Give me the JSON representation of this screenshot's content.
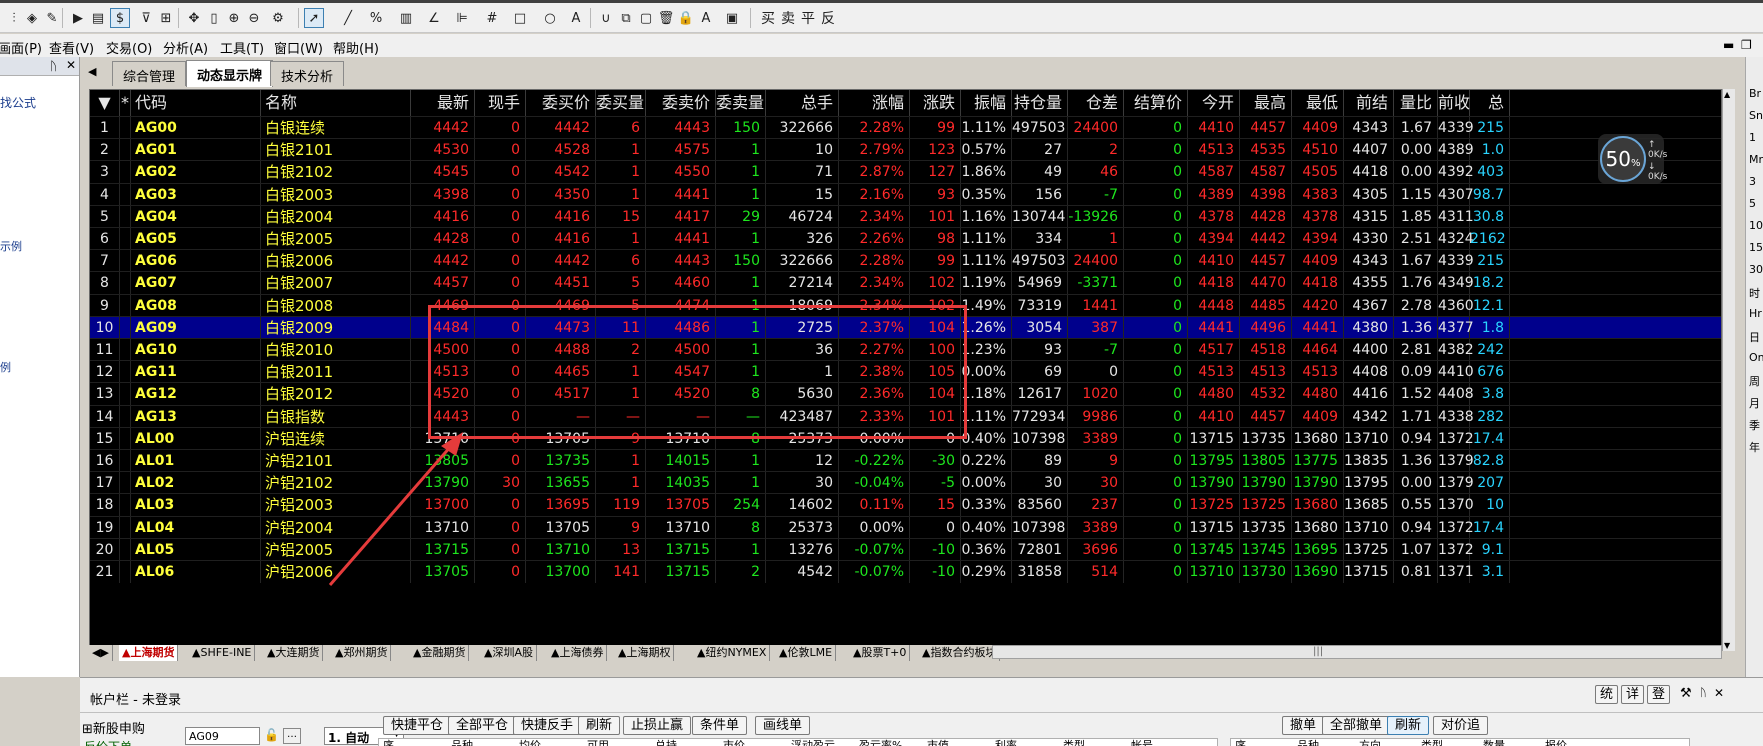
{
  "toolbar": {
    "currency_symbol": "$",
    "buy": "买",
    "sell": "卖",
    "close": "平",
    "reverse": "反"
  },
  "menu": [
    "画面(P)",
    "查看(V)",
    "交易(O)",
    "分析(A)",
    "工具(T)",
    "窗口(W)",
    "帮助(H)"
  ],
  "left_panel": {
    "items": [
      "找公式",
      "示例",
      "例"
    ]
  },
  "tabs": [
    "综合管理",
    "动态显示牌",
    "技术分析"
  ],
  "colors": {
    "up": "#ff2a2a",
    "down": "#1ee61e",
    "flat": "#e6e6e6",
    "name": "#ffff3c",
    "volume_ratio_value": "#2ad4ff",
    "selected_row": "#00008c",
    "annotation": "#e53b3b"
  },
  "table": {
    "columns": [
      "▼",
      "*",
      "代码",
      "名称",
      "最新",
      "现手",
      "委买价",
      "委买量",
      "委卖价",
      "委卖量",
      "总手",
      "涨幅",
      "涨跌",
      "振幅",
      "持仓量",
      "仓差",
      "结算价",
      "今开",
      "最高",
      "最低",
      "前结",
      "量比",
      "前收",
      "总"
    ],
    "selected_row": 10,
    "rows": [
      {
        "n": "1",
        "code": "AG00",
        "name": "白银连续",
        "last": "4442",
        "cur": "0",
        "bid": "4442",
        "bidq": "6",
        "ask": "4443",
        "askq": "150",
        "vol": "322666",
        "pct": "2.28%",
        "chg": "99",
        "amp": "1.11%",
        "oi": "497503",
        "oid": "24400",
        "settle": "0",
        "open": "4410",
        "high": "4457",
        "low": "4409",
        "pset": "4343",
        "vr": "1.67",
        "pclose": "4339",
        "tot": "215"
      },
      {
        "n": "2",
        "code": "AG01",
        "name": "白银2101",
        "last": "4530",
        "cur": "0",
        "bid": "4528",
        "bidq": "1",
        "ask": "4575",
        "askq": "1",
        "vol": "10",
        "pct": "2.79%",
        "chg": "123",
        "amp": "0.57%",
        "oi": "27",
        "oid": "2",
        "settle": "0",
        "open": "4513",
        "high": "4535",
        "low": "4510",
        "pset": "4407",
        "vr": "0.00",
        "pclose": "4389",
        "tot": "1.0"
      },
      {
        "n": "3",
        "code": "AG02",
        "name": "白银2102",
        "last": "4545",
        "cur": "0",
        "bid": "4542",
        "bidq": "1",
        "ask": "4550",
        "askq": "1",
        "vol": "71",
        "pct": "2.87%",
        "chg": "127",
        "amp": "1.86%",
        "oi": "49",
        "oid": "46",
        "settle": "0",
        "open": "4587",
        "high": "4587",
        "low": "4505",
        "pset": "4418",
        "vr": "0.00",
        "pclose": "4392",
        "tot": "403"
      },
      {
        "n": "4",
        "code": "AG03",
        "name": "白银2003",
        "last": "4398",
        "cur": "0",
        "bid": "4350",
        "bidq": "1",
        "ask": "4441",
        "askq": "1",
        "vol": "15",
        "pct": "2.16%",
        "chg": "93",
        "amp": "0.35%",
        "oi": "156",
        "oid": "-7",
        "settle": "0",
        "open": "4389",
        "high": "4398",
        "low": "4383",
        "pset": "4305",
        "vr": "1.15",
        "pclose": "4307",
        "tot": "98.7"
      },
      {
        "n": "5",
        "code": "AG04",
        "name": "白银2004",
        "last": "4416",
        "cur": "0",
        "bid": "4416",
        "bidq": "15",
        "ask": "4417",
        "askq": "29",
        "vol": "46724",
        "pct": "2.34%",
        "chg": "101",
        "amp": "1.16%",
        "oi": "130744",
        "oid": "-13926",
        "settle": "0",
        "open": "4378",
        "high": "4428",
        "low": "4378",
        "pset": "4315",
        "vr": "1.85",
        "pclose": "4311",
        "tot": "30.8"
      },
      {
        "n": "6",
        "code": "AG05",
        "name": "白银2005",
        "last": "4428",
        "cur": "0",
        "bid": "4416",
        "bidq": "1",
        "ask": "4441",
        "askq": "1",
        "vol": "326",
        "pct": "2.26%",
        "chg": "98",
        "amp": "1.11%",
        "oi": "334",
        "oid": "1",
        "settle": "0",
        "open": "4394",
        "high": "4442",
        "low": "4394",
        "pset": "4330",
        "vr": "2.51",
        "pclose": "4324",
        "tot": "2162"
      },
      {
        "n": "7",
        "code": "AG06",
        "name": "白银2006",
        "last": "4442",
        "cur": "0",
        "bid": "4442",
        "bidq": "6",
        "ask": "4443",
        "askq": "150",
        "vol": "322666",
        "pct": "2.28%",
        "chg": "99",
        "amp": "1.11%",
        "oi": "497503",
        "oid": "24400",
        "settle": "0",
        "open": "4410",
        "high": "4457",
        "low": "4409",
        "pset": "4343",
        "vr": "1.67",
        "pclose": "4339",
        "tot": "215"
      },
      {
        "n": "8",
        "code": "AG07",
        "name": "白银2007",
        "last": "4457",
        "cur": "0",
        "bid": "4451",
        "bidq": "5",
        "ask": "4460",
        "askq": "1",
        "vol": "27214",
        "pct": "2.34%",
        "chg": "102",
        "amp": "1.19%",
        "oi": "54969",
        "oid": "-3371",
        "settle": "0",
        "open": "4418",
        "high": "4470",
        "low": "4418",
        "pset": "4355",
        "vr": "1.76",
        "pclose": "4349",
        "tot": "18.2"
      },
      {
        "n": "9",
        "code": "AG08",
        "name": "白银2008",
        "last": "4469",
        "cur": "0",
        "bid": "4469",
        "bidq": "5",
        "ask": "4474",
        "askq": "1",
        "vol": "18069",
        "pct": "2.34%",
        "chg": "102",
        "amp": "1.49%",
        "oi": "73319",
        "oid": "1441",
        "settle": "0",
        "open": "4448",
        "high": "4485",
        "low": "4420",
        "pset": "4367",
        "vr": "2.78",
        "pclose": "4360",
        "tot": "12.1"
      },
      {
        "n": "10",
        "code": "AG09",
        "name": "白银2009",
        "last": "4484",
        "cur": "0",
        "bid": "4473",
        "bidq": "11",
        "ask": "4486",
        "askq": "1",
        "vol": "2725",
        "pct": "2.37%",
        "chg": "104",
        "amp": "1.26%",
        "oi": "3054",
        "oid": "387",
        "settle": "0",
        "open": "4441",
        "high": "4496",
        "low": "4441",
        "pset": "4380",
        "vr": "1.36",
        "pclose": "4377",
        "tot": "1.8"
      },
      {
        "n": "11",
        "code": "AG10",
        "name": "白银2010",
        "last": "4500",
        "cur": "0",
        "bid": "4488",
        "bidq": "2",
        "ask": "4500",
        "askq": "1",
        "vol": "36",
        "pct": "2.27%",
        "chg": "100",
        "amp": "1.23%",
        "oi": "93",
        "oid": "-7",
        "settle": "0",
        "open": "4517",
        "high": "4518",
        "low": "4464",
        "pset": "4400",
        "vr": "2.81",
        "pclose": "4382",
        "tot": "242"
      },
      {
        "n": "12",
        "code": "AG11",
        "name": "白银2011",
        "last": "4513",
        "cur": "0",
        "bid": "4465",
        "bidq": "1",
        "ask": "4547",
        "askq": "1",
        "vol": "1",
        "pct": "2.38%",
        "chg": "105",
        "amp": "0.00%",
        "oi": "69",
        "oid": "0",
        "settle": "0",
        "open": "4513",
        "high": "4513",
        "low": "4513",
        "pset": "4408",
        "vr": "0.09",
        "pclose": "4410",
        "tot": "676"
      },
      {
        "n": "13",
        "code": "AG12",
        "name": "白银2012",
        "last": "4520",
        "cur": "0",
        "bid": "4517",
        "bidq": "1",
        "ask": "4520",
        "askq": "8",
        "vol": "5630",
        "pct": "2.36%",
        "chg": "104",
        "amp": "1.18%",
        "oi": "12617",
        "oid": "1020",
        "settle": "0",
        "open": "4480",
        "high": "4532",
        "low": "4480",
        "pset": "4416",
        "vr": "1.52",
        "pclose": "4408",
        "tot": "3.8"
      },
      {
        "n": "14",
        "code": "AG13",
        "name": "白银指数",
        "last": "4443",
        "cur": "0",
        "bid": "—",
        "bidq": "—",
        "ask": "—",
        "askq": "—",
        "vol": "423487",
        "pct": "2.33%",
        "chg": "101",
        "amp": "1.11%",
        "oi": "772934",
        "oid": "9986",
        "settle": "0",
        "open": "4410",
        "high": "4457",
        "low": "4409",
        "pset": "4342",
        "vr": "1.71",
        "pclose": "4338",
        "tot": "282"
      },
      {
        "n": "15",
        "code": "AL00",
        "name": "沪铝连续",
        "last": "13710",
        "cur": "0",
        "bid": "13705",
        "bidq": "9",
        "ask": "13710",
        "askq": "8",
        "vol": "25373",
        "pct": "0.00%",
        "chg": "0",
        "amp": "0.40%",
        "oi": "107398",
        "oid": "3389",
        "settle": "0",
        "open": "13715",
        "high": "13735",
        "low": "13680",
        "pset": "13710",
        "vr": "0.94",
        "pclose": "1372",
        "tot": "17.4"
      },
      {
        "n": "16",
        "code": "AL01",
        "name": "沪铝2101",
        "last": "13805",
        "cur": "0",
        "bid": "13735",
        "bidq": "1",
        "ask": "14015",
        "askq": "1",
        "vol": "12",
        "pct": "-0.22%",
        "chg": "-30",
        "amp": "0.22%",
        "oi": "89",
        "oid": "9",
        "settle": "0",
        "open": "13795",
        "high": "13805",
        "low": "13775",
        "pset": "13835",
        "vr": "1.36",
        "pclose": "1379",
        "tot": "82.8"
      },
      {
        "n": "17",
        "code": "AL02",
        "name": "沪铝2102",
        "last": "13790",
        "cur": "30",
        "bid": "13655",
        "bidq": "1",
        "ask": "14035",
        "askq": "1",
        "vol": "30",
        "pct": "-0.04%",
        "chg": "-5",
        "amp": "0.00%",
        "oi": "30",
        "oid": "30",
        "settle": "0",
        "open": "13790",
        "high": "13790",
        "low": "13790",
        "pset": "13795",
        "vr": "0.00",
        "pclose": "1379",
        "tot": "207"
      },
      {
        "n": "18",
        "code": "AL03",
        "name": "沪铝2003",
        "last": "13700",
        "cur": "0",
        "bid": "13695",
        "bidq": "119",
        "ask": "13705",
        "askq": "254",
        "vol": "14602",
        "pct": "0.11%",
        "chg": "15",
        "amp": "0.33%",
        "oi": "83560",
        "oid": "237",
        "settle": "0",
        "open": "13725",
        "high": "13725",
        "low": "13680",
        "pset": "13685",
        "vr": "0.55",
        "pclose": "1370",
        "tot": "10"
      },
      {
        "n": "19",
        "code": "AL04",
        "name": "沪铝2004",
        "last": "13710",
        "cur": "0",
        "bid": "13705",
        "bidq": "9",
        "ask": "13710",
        "askq": "8",
        "vol": "25373",
        "pct": "0.00%",
        "chg": "0",
        "amp": "0.40%",
        "oi": "107398",
        "oid": "3389",
        "settle": "0",
        "open": "13715",
        "high": "13735",
        "low": "13680",
        "pset": "13710",
        "vr": "0.94",
        "pclose": "1372",
        "tot": "17.4"
      },
      {
        "n": "20",
        "code": "AL05",
        "name": "沪铝2005",
        "last": "13715",
        "cur": "0",
        "bid": "13710",
        "bidq": "13",
        "ask": "13715",
        "askq": "1",
        "vol": "13276",
        "pct": "-0.07%",
        "chg": "-10",
        "amp": "0.36%",
        "oi": "72801",
        "oid": "3696",
        "settle": "0",
        "open": "13745",
        "high": "13745",
        "low": "13695",
        "pset": "13725",
        "vr": "1.07",
        "pclose": "1372",
        "tot": "9.1"
      },
      {
        "n": "21",
        "code": "AL06",
        "name": "沪铝2006",
        "last": "13705",
        "cur": "0",
        "bid": "13700",
        "bidq": "141",
        "ask": "13715",
        "askq": "2",
        "vol": "4542",
        "pct": "-0.07%",
        "chg": "-10",
        "amp": "0.29%",
        "oi": "31858",
        "oid": "514",
        "settle": "0",
        "open": "13710",
        "high": "13730",
        "low": "13690",
        "pset": "13715",
        "vr": "0.81",
        "pclose": "1371",
        "tot": "3.1"
      }
    ]
  },
  "speed_widget": {
    "percent": "50",
    "up": "↑ 0K/s",
    "down": "↓ 0K/s"
  },
  "sheets": [
    "▲上海期货",
    "▲SHFE-INE",
    "▲大连期货",
    "▲郑州期货",
    "▲金融期货",
    "▲深圳A股",
    "▲上海债券",
    "▲上海期权",
    "▲纽约NYMEX",
    "▲伦敦LME",
    "▲股票T+0",
    "▲指数合约板块"
  ],
  "right_rail": [
    "Br",
    "Sn",
    "1",
    "Mn",
    "3",
    "5",
    "10",
    "15",
    "30",
    "时",
    "Hr",
    "日",
    "On",
    "周",
    "月",
    "季",
    "年"
  ],
  "account": {
    "title": "帐户栏 - 未登录",
    "right_btns": [
      "统",
      "详",
      "登"
    ],
    "tree": [
      "新股申购",
      "反价下单"
    ],
    "code": "AG09",
    "mode": "1. 自动",
    "buttons": [
      "快捷平仓",
      "全部平仓",
      "快捷反手",
      "刷新",
      "止损止赢",
      "条件单",
      "画线单",
      "撤单",
      "全部撤单",
      "刷新",
      "对价追"
    ],
    "positions_cols": [
      "序",
      "品种",
      "均价",
      "可用",
      "总持",
      "市价",
      "浮动盈亏",
      "盈亏率%",
      "市值",
      "利率",
      "类型",
      "帐号"
    ],
    "orders_cols": [
      "序",
      "品种",
      "方向",
      "类型",
      "数量",
      "报价"
    ]
  }
}
